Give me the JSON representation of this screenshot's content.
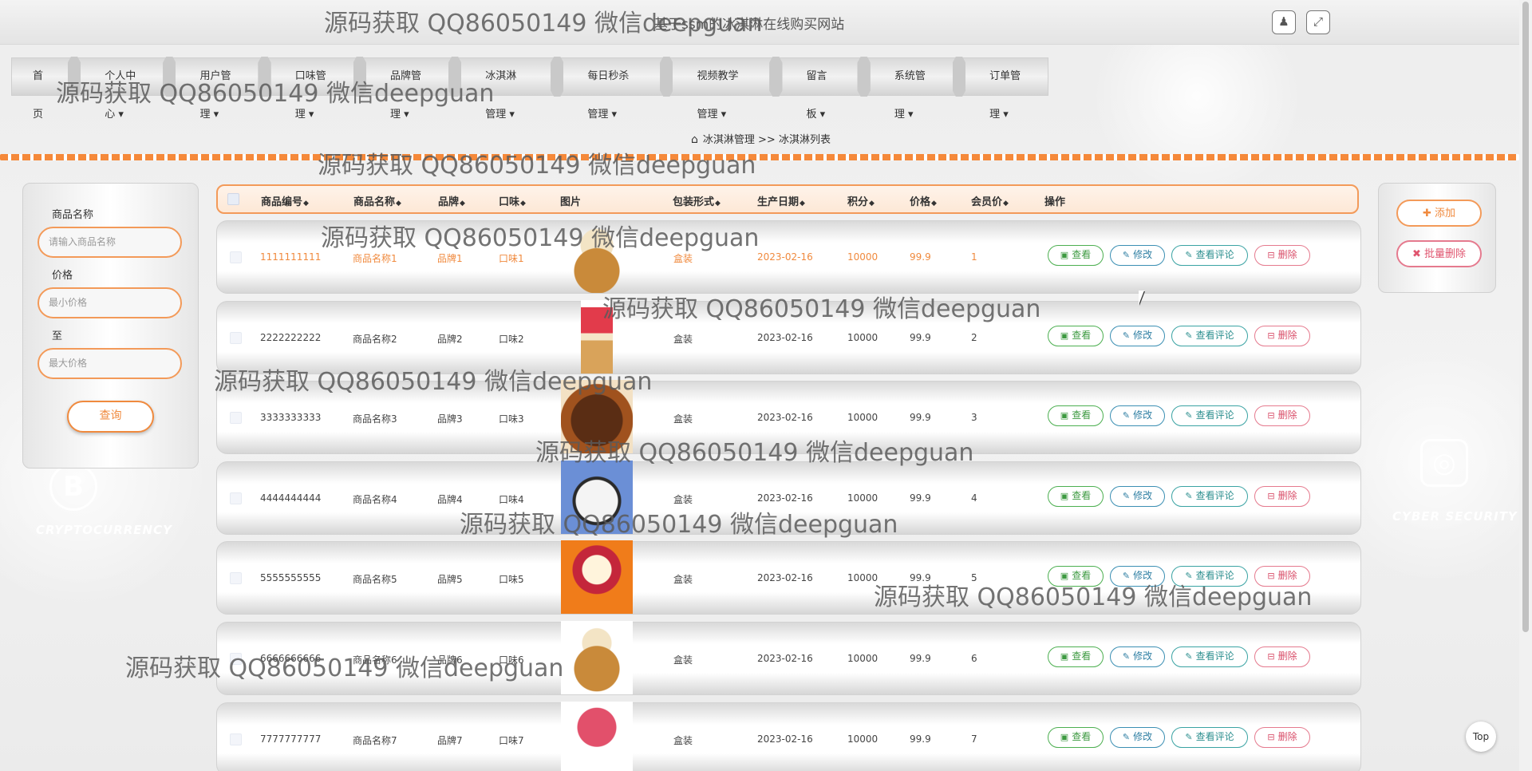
{
  "header": {
    "site_title": "基于ssm的冰淇淋在线购买网站",
    "user_icon": "user-icon",
    "fullscreen_icon": "fullscreen-icon"
  },
  "nav": {
    "items": [
      {
        "label": "首页"
      },
      {
        "label": "个人中心 ▾"
      },
      {
        "label": "用户管理 ▾"
      },
      {
        "label": "口味管理 ▾"
      },
      {
        "label": "品牌管理 ▾"
      },
      {
        "label": "冰淇淋管理 ▾"
      },
      {
        "label": "每日秒杀管理 ▾"
      },
      {
        "label": "视频教学管理 ▾"
      },
      {
        "label": "留言板 ▾"
      },
      {
        "label": "系统管理 ▾"
      },
      {
        "label": "订单管理 ▾"
      }
    ]
  },
  "breadcrumb": {
    "text": "冰淇淋管理 >> 冰淇淋列表"
  },
  "search": {
    "name_label": "商品名称",
    "name_placeholder": "请输入商品名称",
    "price_label": "价格",
    "min_placeholder": "最小价格",
    "to_label": "至",
    "max_placeholder": "最大价格",
    "query_button": "查询"
  },
  "actions": {
    "add_button": "✚ 添加",
    "batch_delete_button": "✖ 批量删除"
  },
  "table": {
    "headers": {
      "code": "商品编号",
      "name": "商品名称",
      "brand": "品牌",
      "flavor": "口味",
      "image": "图片",
      "package": "包装形式",
      "date": "生产日期",
      "points": "积分",
      "price": "价格",
      "member_price": "会员价",
      "ops": "操作"
    },
    "buttons": {
      "view": "查看",
      "edit": "修改",
      "comments": "查看评论",
      "delete": "删除"
    },
    "rows": [
      {
        "code": "1111111111",
        "name": "商品名称1",
        "brand": "品牌1",
        "flavor": "口味1",
        "package": "盒装",
        "date": "2023-02-16",
        "points": "10000",
        "price": "99.9",
        "member_price": "1"
      },
      {
        "code": "2222222222",
        "name": "商品名称2",
        "brand": "品牌2",
        "flavor": "口味2",
        "package": "盒装",
        "date": "2023-02-16",
        "points": "10000",
        "price": "99.9",
        "member_price": "2"
      },
      {
        "code": "3333333333",
        "name": "商品名称3",
        "brand": "品牌3",
        "flavor": "口味3",
        "package": "盒装",
        "date": "2023-02-16",
        "points": "10000",
        "price": "99.9",
        "member_price": "3"
      },
      {
        "code": "4444444444",
        "name": "商品名称4",
        "brand": "品牌4",
        "flavor": "口味4",
        "package": "盒装",
        "date": "2023-02-16",
        "points": "10000",
        "price": "99.9",
        "member_price": "4"
      },
      {
        "code": "5555555555",
        "name": "商品名称5",
        "brand": "品牌5",
        "flavor": "口味5",
        "package": "盒装",
        "date": "2023-02-16",
        "points": "10000",
        "price": "99.9",
        "member_price": "5"
      },
      {
        "code": "6666666666",
        "name": "商品名称6",
        "brand": "品牌6",
        "flavor": "口味6",
        "package": "盒装",
        "date": "2023-02-16",
        "points": "10000",
        "price": "99.9",
        "member_price": "6"
      },
      {
        "code": "7777777777",
        "name": "商品名称7",
        "brand": "品牌7",
        "flavor": "口味7",
        "package": "盒装",
        "date": "2023-02-16",
        "points": "10000",
        "price": "99.9",
        "member_price": "7"
      }
    ]
  },
  "background": {
    "text_crypto": "CRYPTOCURRENCY",
    "text_cyber": "CYBER SECURITY"
  },
  "top_button": "Top",
  "watermark": "源码获取 QQ86050149 微信deepguan",
  "colors": {
    "accent": "#f08a3e",
    "view": "#4caf50",
    "edit": "#3b8fb3",
    "comments": "#3aa3a3",
    "delete": "#e57a8e"
  }
}
